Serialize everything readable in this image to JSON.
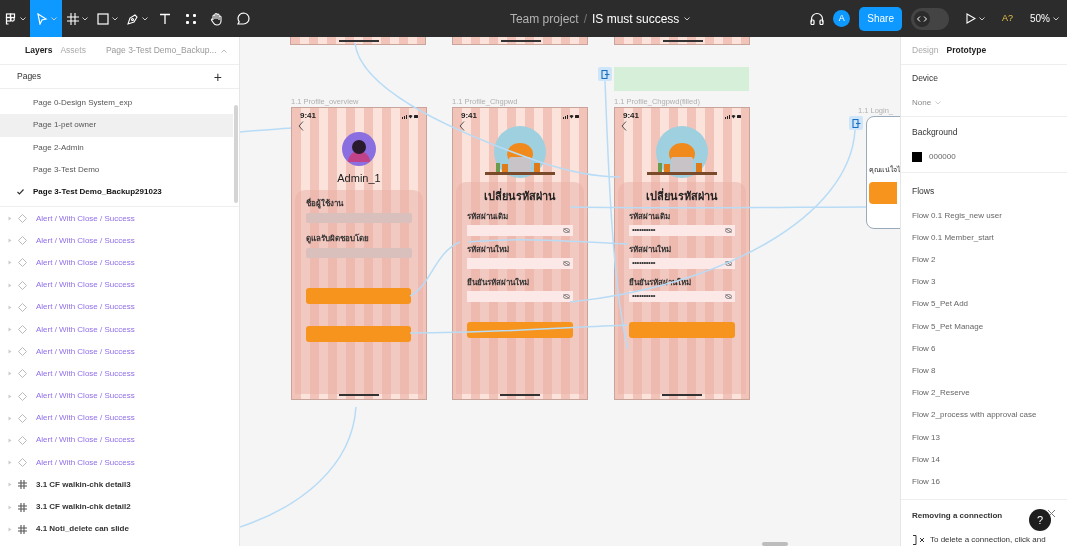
{
  "toolbar": {
    "tools": [
      {
        "kind": "menu",
        "selected": false
      },
      {
        "kind": "move",
        "selected": true
      },
      {
        "kind": "frame",
        "selected": false
      },
      {
        "kind": "shape",
        "selected": false
      },
      {
        "kind": "pen",
        "selected": false
      },
      {
        "kind": "text",
        "selected": false
      },
      {
        "kind": "resources",
        "selected": false
      },
      {
        "kind": "hand",
        "selected": false
      },
      {
        "kind": "comment",
        "selected": false
      }
    ],
    "project": "Team project",
    "separator": "/",
    "file": "IS must success",
    "avatar": "A",
    "share": "Share",
    "dev_mode": false,
    "shortcut": "A?",
    "zoom": "50%"
  },
  "left_panel": {
    "tabs": [
      {
        "label": "Layers",
        "selected": true
      },
      {
        "label": "Assets",
        "selected": false
      }
    ],
    "page_selector": "Page 3-Test Demo_Backup...",
    "pages_title": "Pages",
    "add": "+",
    "pages": [
      {
        "label": "Page 0-Design System_exp",
        "selected": false,
        "hovered": false
      },
      {
        "label": "Page 1-pet owner",
        "selected": false,
        "hovered": true
      },
      {
        "label": "Page 2-Admin",
        "selected": false,
        "hovered": false
      },
      {
        "label": "Page 3-Test Demo",
        "selected": false,
        "hovered": false
      },
      {
        "label": "Page 3-Test Demo_Backup291023",
        "selected": true,
        "hovered": false
      }
    ],
    "layers": [
      {
        "kind": "component",
        "label": "Alert / With Close / Success"
      },
      {
        "kind": "component",
        "label": "Alert / With Close / Success"
      },
      {
        "kind": "component",
        "label": "Alert / With Close / Success"
      },
      {
        "kind": "component",
        "label": "Alert / With Close / Success"
      },
      {
        "kind": "component",
        "label": "Alert / With Close / Success"
      },
      {
        "kind": "component",
        "label": "Alert / With Close / Success"
      },
      {
        "kind": "component",
        "label": "Alert / With Close / Success"
      },
      {
        "kind": "component",
        "label": "Alert / With Close / Success"
      },
      {
        "kind": "component",
        "label": "Alert / With Close / Success"
      },
      {
        "kind": "component",
        "label": "Alert / With Close / Success"
      },
      {
        "kind": "component",
        "label": "Alert / With Close / Success"
      },
      {
        "kind": "component",
        "label": "Alert / With Close / Success"
      },
      {
        "kind": "frame",
        "label": "3.1 CF walkin-chk detail3"
      },
      {
        "kind": "frame",
        "label": "3.1 CF walkin-chk detail2"
      },
      {
        "kind": "frame",
        "label": "4.1 Noti_delete can slide"
      }
    ]
  },
  "canvas": {
    "frames": [
      {
        "kind": "profile",
        "label": "1.1 Profile_overview",
        "time": "9:41",
        "name": "Admin_1",
        "fields": [
          {
            "label": "ชื่อผู้ใช้งาน"
          },
          {
            "label": "ดูแลรับผิดชอบโดย"
          }
        ]
      },
      {
        "kind": "change_password",
        "label": "1.1 Profile_Chgpwd",
        "time": "9:41",
        "title": "เปลี่ยนรหัสผ่าน",
        "fields": [
          {
            "label": "รหัสผ่านเดิม"
          },
          {
            "label": "รหัสผ่านใหม่"
          },
          {
            "label": "ยืนยันรหัสผ่านใหม่"
          }
        ]
      },
      {
        "kind": "change_password",
        "label": "1.1 Profile_Chgpwd(filled)",
        "time": "9:41",
        "title": "เปลี่ยนรหัสผ่าน",
        "fields": [
          {
            "label": "รหัสผ่านเดิม",
            "value": "••••••••••"
          },
          {
            "label": "รหัสผ่านใหม่",
            "value": "••••••••••"
          },
          {
            "label": "ยืนยันรหัสผ่านใหม่",
            "value": "••••••••••"
          }
        ]
      },
      {
        "kind": "login",
        "label": "1.1 Login_",
        "text": "คุณแน่ใจไ"
      }
    ]
  },
  "right_panel": {
    "tabs": [
      {
        "label": "Design",
        "selected": false
      },
      {
        "label": "Prototype",
        "selected": true
      }
    ],
    "device_title": "Device",
    "device": "None",
    "background_title": "Background",
    "background_color": "000000",
    "flows_title": "Flows",
    "flows": [
      "Flow 0.1 Regis_new user",
      "Flow 0.1 Member_start",
      "Flow 2",
      "Flow 3",
      "Flow 5_Pet Add",
      "Flow 5_Pet Manage",
      "Flow 6",
      "Flow 8",
      "Flow 2_Reserve",
      "Flow 2_process with approval case",
      "Flow 13",
      "Flow 14",
      "Flow 16"
    ],
    "tip_title": "Removing a connection",
    "tip_text": "To delete a connection, click and",
    "help": "?"
  }
}
